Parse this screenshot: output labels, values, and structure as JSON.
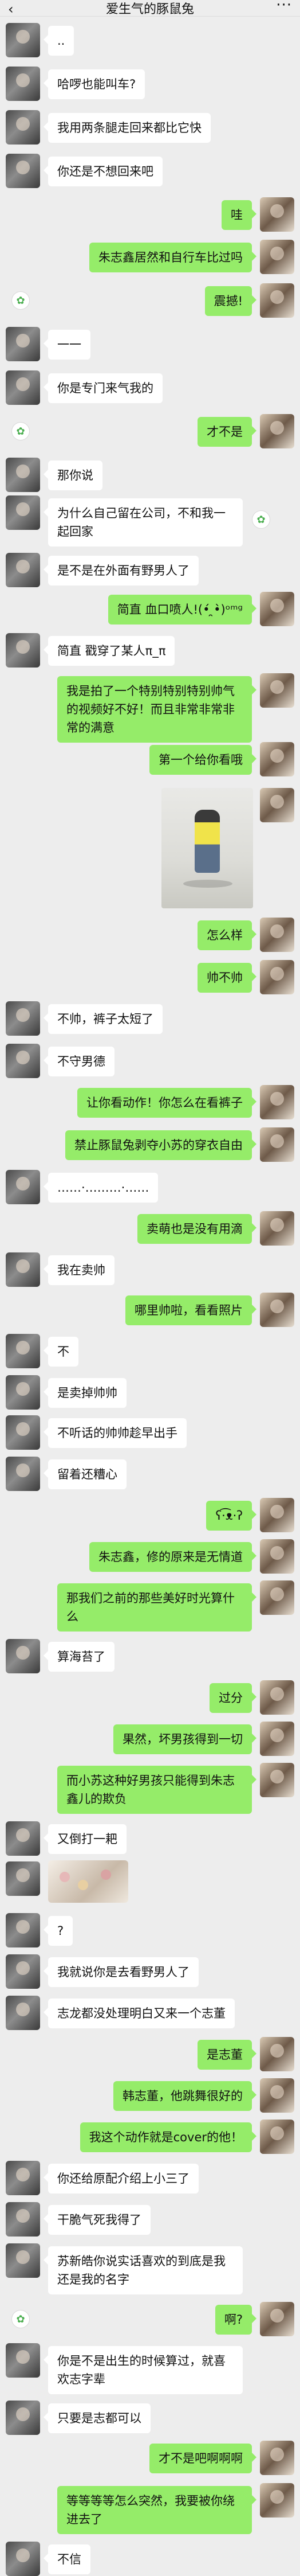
{
  "header": {
    "title": "爱生气的豚鼠兔",
    "back_icon": "chevron-left-icon",
    "more_icon": "more-dots-icon"
  },
  "colors": {
    "background": "#ededed",
    "own_bubble": "#95ec69",
    "other_bubble": "#ffffff"
  },
  "messages": [
    {
      "side": "left",
      "text": "..",
      "translate": false
    },
    {
      "side": "left",
      "text": "哈啰也能叫车?",
      "translate": false
    },
    {
      "side": "left",
      "text": "我用两条腿走回来都比它快",
      "translate": false
    },
    {
      "side": "left",
      "text": "你还是不想回来吧",
      "translate": false
    },
    {
      "side": "right",
      "text": "哇",
      "translate": false
    },
    {
      "side": "right",
      "text": "朱志鑫居然和自行车比过吗",
      "translate": false
    },
    {
      "side": "right",
      "text": "震撼!",
      "translate": true
    },
    {
      "side": "left",
      "text": "一一",
      "translate": false
    },
    {
      "side": "left",
      "text": "你是专门来气我的",
      "translate": false
    },
    {
      "side": "right",
      "text": "才不是",
      "translate": true
    },
    {
      "side": "left",
      "text": "那你说",
      "translate": false
    },
    {
      "side": "left",
      "text": "为什么自己留在公司，不和我一起回家",
      "translate": true
    },
    {
      "side": "left",
      "text": "是不是在外面有野男人了",
      "translate": false
    },
    {
      "side": "right",
      "text": "简直 血口喷人!(•́ ̯•̀)ᵒᵐᵍ",
      "translate": false
    },
    {
      "side": "left",
      "text": "简直 戳穿了某人π_π",
      "translate": false
    },
    {
      "side": "right",
      "text": "我是拍了一个特别特别特别帅气的视频好不好！而且非常非常非常的满意",
      "translate": false
    },
    {
      "side": "right",
      "text": "第一个给你看哦",
      "translate": false
    },
    {
      "side": "right",
      "text": "",
      "translate": false,
      "photo": true
    },
    {
      "side": "right",
      "text": "怎么样",
      "translate": false
    },
    {
      "side": "right",
      "text": "帅不帅",
      "translate": false
    },
    {
      "side": "left",
      "text": "不帅，裤子太短了",
      "translate": false
    },
    {
      "side": "left",
      "text": "不守男德",
      "translate": false
    },
    {
      "side": "right",
      "text": "让你看动作！你怎么在看裤子",
      "translate": false
    },
    {
      "side": "right",
      "text": "禁止豚鼠兔剥夺小苏的穿衣自由",
      "translate": false
    },
    {
      "side": "left",
      "text": "……·………·……",
      "translate": false
    },
    {
      "side": "right",
      "text": "卖萌也是没有用滴",
      "translate": false
    },
    {
      "side": "left",
      "text": "我在卖帅",
      "translate": false
    },
    {
      "side": "right",
      "text": "哪里帅啦，看看照片",
      "translate": false
    },
    {
      "side": "left",
      "text": "不",
      "translate": false
    },
    {
      "side": "left",
      "text": "是卖掉帅帅",
      "translate": false
    },
    {
      "side": "left",
      "text": "不听话的帅帅趁早出手",
      "translate": false
    },
    {
      "side": "left",
      "text": "留着还糟心",
      "translate": false
    },
    {
      "side": "right",
      "text": "ʕ·͡ᴥ·ʔ",
      "translate": false
    },
    {
      "side": "right",
      "text": "朱志鑫，修的原来是无情道",
      "translate": false
    },
    {
      "side": "right",
      "text": "那我们之前的那些美好时光算什么",
      "translate": false
    },
    {
      "side": "left",
      "text": "算海苔了",
      "translate": false
    },
    {
      "side": "right",
      "text": "过分",
      "translate": false
    },
    {
      "side": "right",
      "text": "果然，坏男孩得到一切",
      "translate": false
    },
    {
      "side": "right",
      "text": "而小苏这种好男孩只能得到朱志鑫儿的欺负",
      "translate": false
    },
    {
      "side": "left",
      "text": "又倒打一耙",
      "translate": false
    },
    {
      "side": "left",
      "text": "",
      "translate": false,
      "sticker": true
    },
    {
      "side": "left",
      "text": "?",
      "translate": false
    },
    {
      "side": "left",
      "text": "我就说你是去看野男人了",
      "translate": false
    },
    {
      "side": "left",
      "text": "志龙都没处理明白又来一个志董",
      "translate": false
    },
    {
      "side": "right",
      "text": "是志董",
      "translate": false
    },
    {
      "side": "right",
      "text": "韩志董，他跳舞很好的",
      "translate": false
    },
    {
      "side": "right",
      "text": "我这个动作就是cover的他！",
      "translate": false
    },
    {
      "side": "left",
      "text": "你还给原配介绍上小三了",
      "translate": false
    },
    {
      "side": "left",
      "text": "干脆气死我得了",
      "translate": false
    },
    {
      "side": "left",
      "text": "苏新皓你说实话喜欢的到底是我还是我的名字",
      "translate": false
    },
    {
      "side": "right",
      "text": "啊?",
      "translate": true
    },
    {
      "side": "left",
      "text": "你是不是出生的时候算过，就喜欢志字辈",
      "translate": false
    },
    {
      "side": "left",
      "text": "只要是志都可以",
      "translate": false
    },
    {
      "side": "right",
      "text": "才不是吧啊啊啊",
      "translate": false
    },
    {
      "side": "right",
      "text": "等等等等怎么突然，我要被你绕进去了",
      "translate": false
    },
    {
      "side": "left",
      "text": "不信",
      "translate": false
    }
  ]
}
